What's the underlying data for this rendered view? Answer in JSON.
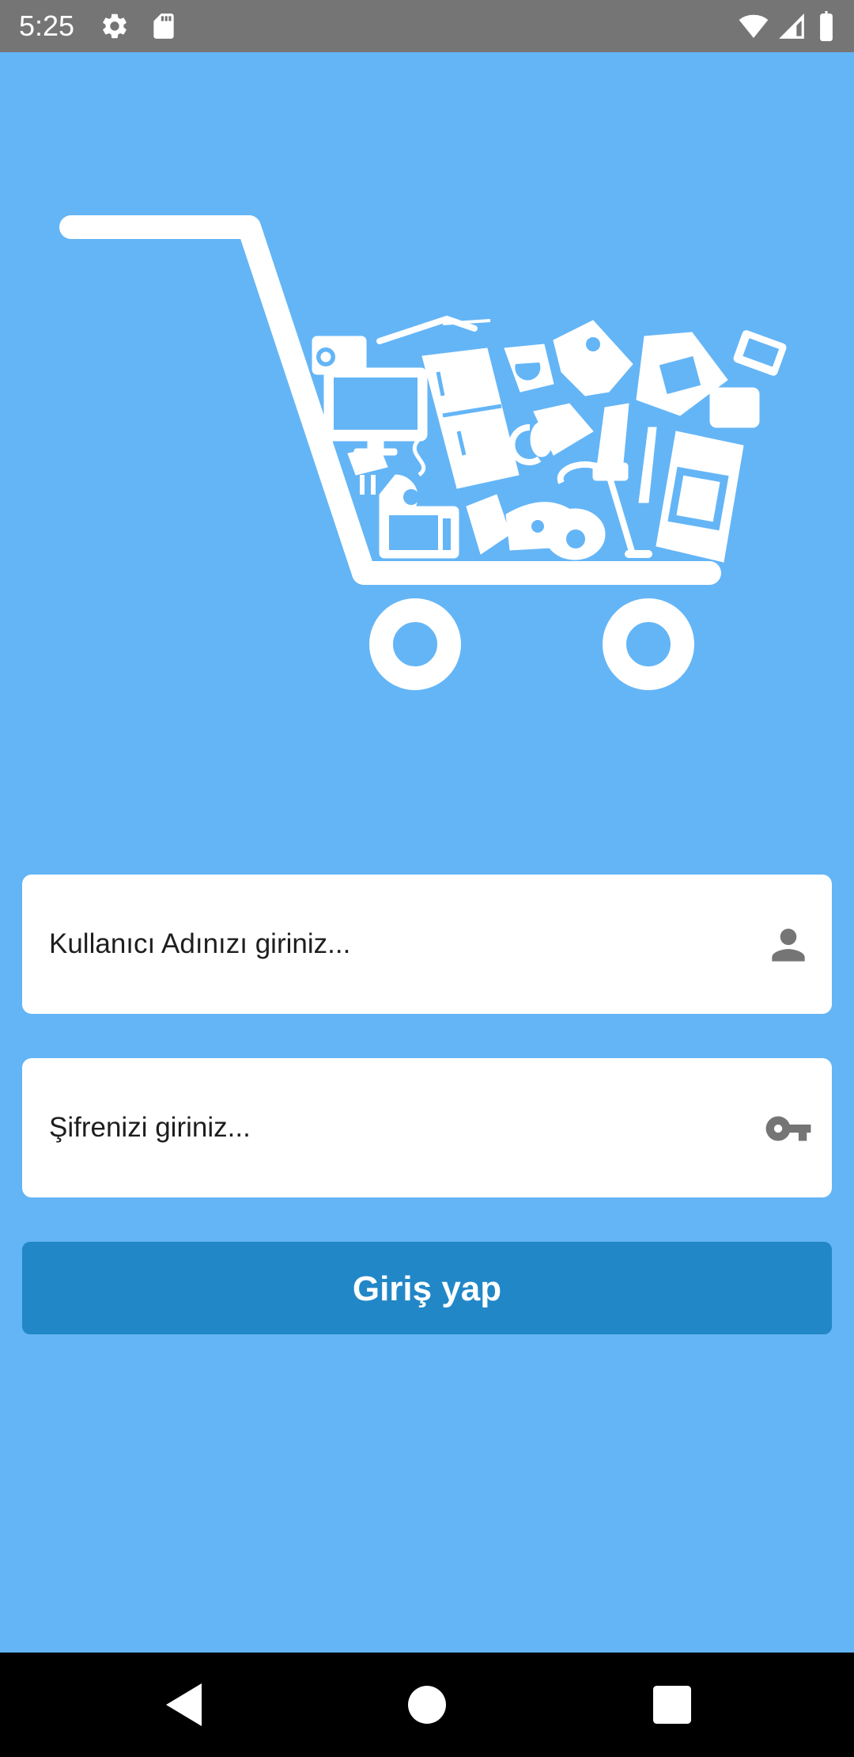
{
  "status_bar": {
    "time": "5:25",
    "icons": [
      "gear-icon",
      "sd-card-icon",
      "wifi-icon",
      "cell-signal-icon",
      "battery-icon"
    ]
  },
  "illustration": {
    "name": "shopping-cart-with-appliances-icon"
  },
  "login_form": {
    "username": {
      "placeholder": "Kullanıcı Adınızı giriniz...",
      "icon": "person-icon"
    },
    "password": {
      "placeholder": "Şifrenizi giriniz...",
      "icon": "key-icon"
    },
    "submit_label": "Giriş yap"
  },
  "navigation_bar": {
    "buttons": [
      "back-icon",
      "home-icon",
      "recents-icon"
    ]
  },
  "colors": {
    "background": "#64B5F6",
    "status_bar": "#757575",
    "field_background": "#FFFFFF",
    "button": "#2287C7",
    "icon_gray": "#757575",
    "nav_bar": "#000000"
  }
}
